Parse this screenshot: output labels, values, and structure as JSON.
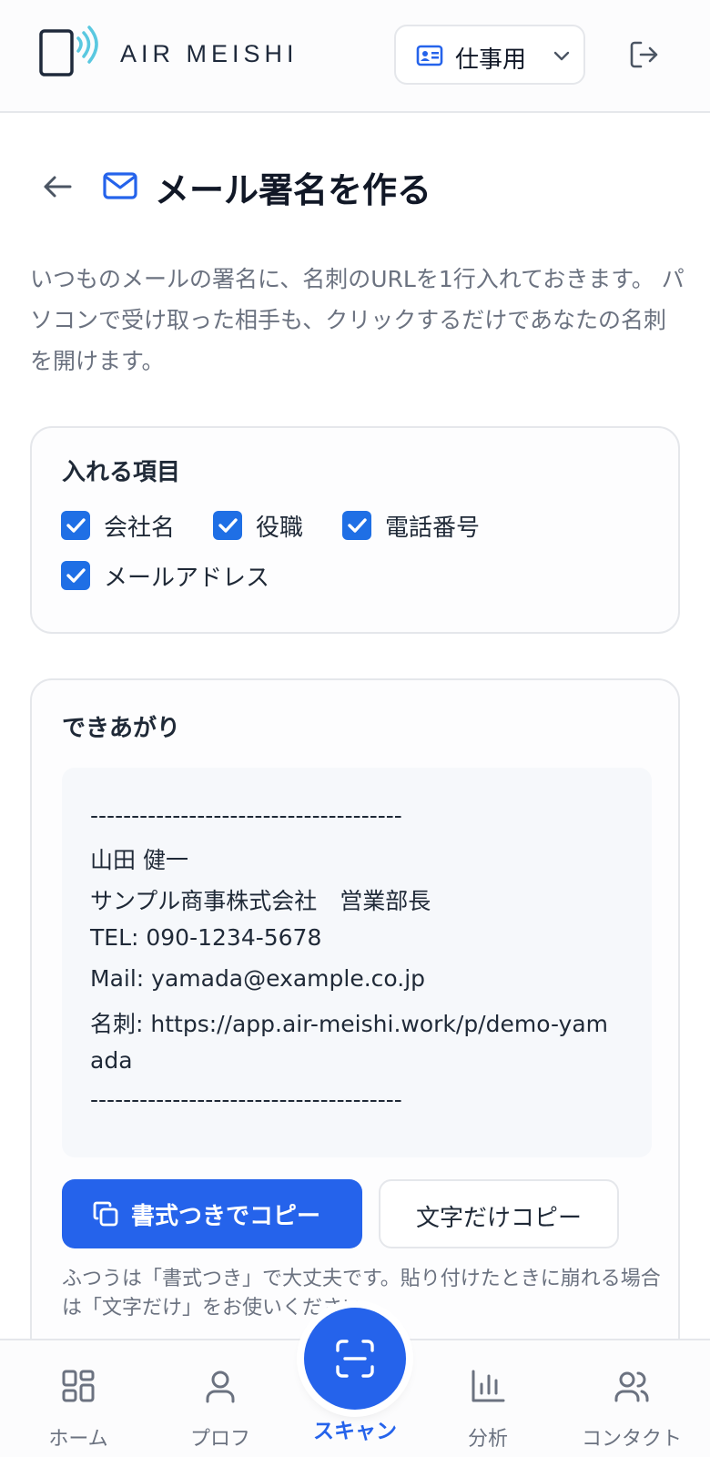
{
  "header": {
    "app_name": "AIR MEISHI",
    "profile_switch_label": "仕事用"
  },
  "page": {
    "title": "メール署名を作る",
    "description": "いつものメールの署名に、名刺のURLを1行入れておきます。 パソコンで受け取った相手も、クリックするだけであなたの名刺を開けます。"
  },
  "items_card": {
    "title": "入れる項目",
    "options": [
      {
        "label": "会社名",
        "checked": true
      },
      {
        "label": "役職",
        "checked": true
      },
      {
        "label": "電話番号",
        "checked": true
      },
      {
        "label": "メールアドレス",
        "checked": true
      }
    ]
  },
  "preview_card": {
    "title": "できあがり",
    "signature_lines": [
      "--------------------------------------",
      "山田 健一",
      "サンプル商事株式会社　営業部長",
      "TEL: 090-1234-5678",
      "Mail: yamada@example.co.jp",
      "名刺: https://app.air-meishi.work/p/demo-yam",
      "ada",
      "--------------------------------------"
    ],
    "copy_formatted_label": "書式つきでコピー",
    "copy_text_label": "文字だけコピー",
    "hint": "ふつうは「書式つき」で大丈夫です。貼り付けたときに崩れる場合は「文字だけ」をお使いください。"
  },
  "bottom_nav": {
    "home": "ホーム",
    "profile": "プロフ",
    "scan": "スキャン",
    "analytics": "分析",
    "contacts": "コンタクト"
  },
  "colors": {
    "accent": "#2563eb",
    "checkbox": "#1f6fe5",
    "logo_wave": "#5ac8e0"
  }
}
